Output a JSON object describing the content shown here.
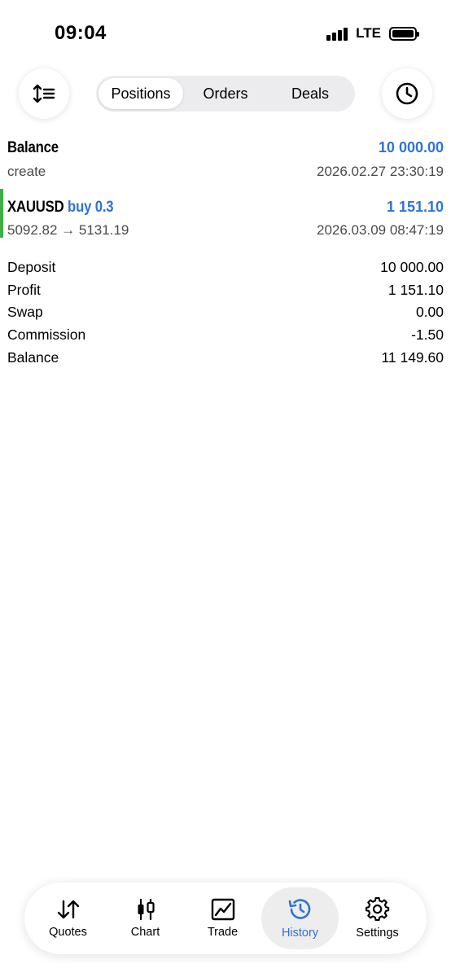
{
  "status_bar": {
    "time": "09:04",
    "network": "LTE"
  },
  "top_bar": {
    "segments": [
      "Positions",
      "Orders",
      "Deals"
    ],
    "active_segment": "Positions",
    "left_icon": "sort-icon",
    "right_icon": "clock-icon"
  },
  "deals": [
    {
      "title": "Balance",
      "title_suffix": "",
      "value": "10 000.00",
      "sub_left": "create",
      "sub_right": "2026.02.27 23:30:19"
    },
    {
      "title": "XAUUSD",
      "title_suffix": "buy 0.3",
      "value": "1 151.10",
      "sub_left": "5092.82 → 5131.19",
      "sub_right": "2026.03.09 08:47:19"
    }
  ],
  "summary": [
    {
      "label": "Deposit",
      "value": "10 000.00"
    },
    {
      "label": "Profit",
      "value": "1 151.10"
    },
    {
      "label": "Swap",
      "value": "0.00"
    },
    {
      "label": "Commission",
      "value": "-1.50"
    },
    {
      "label": "Balance",
      "value": "11 149.60"
    }
  ],
  "tabbar": {
    "tabs": [
      {
        "label": "Quotes",
        "icon": "quotes-icon"
      },
      {
        "label": "Chart",
        "icon": "candlestick-icon"
      },
      {
        "label": "Trade",
        "icon": "trade-chart-icon"
      },
      {
        "label": "History",
        "icon": "history-icon"
      },
      {
        "label": "Settings",
        "icon": "gear-icon"
      }
    ],
    "active_tab": "History"
  },
  "colors": {
    "accent": "#2e73d8",
    "buy_indicator": "#3cb043",
    "segment_bg": "#ececee"
  }
}
